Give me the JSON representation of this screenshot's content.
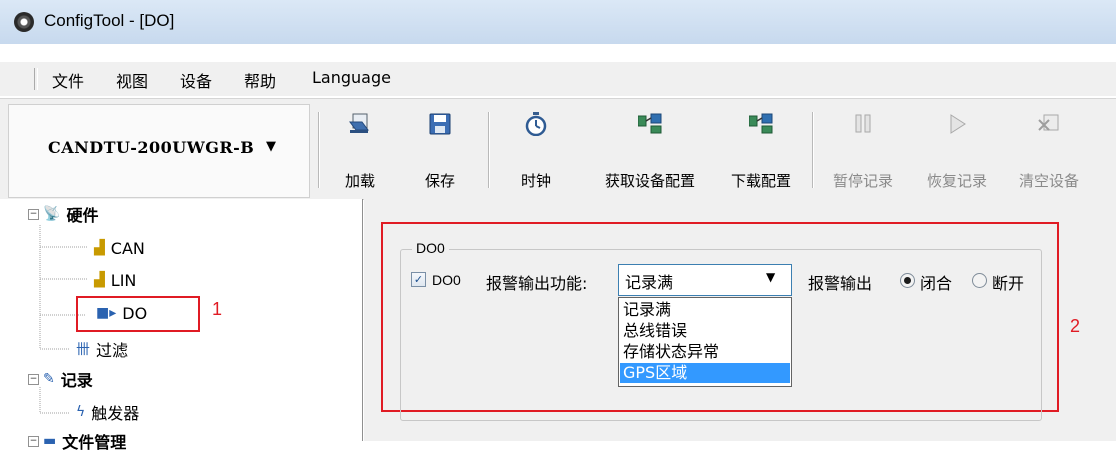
{
  "window": {
    "title": "ConfigTool - [DO]"
  },
  "menu": [
    "文件",
    "视图",
    "设备",
    "帮助",
    "Language"
  ],
  "toolbar": {
    "device": "CANDTU-200UWGR-B",
    "buttons": [
      {
        "label": "加载",
        "icon": "load-icon"
      },
      {
        "label": "保存",
        "icon": "save-icon"
      },
      {
        "label": "时钟",
        "icon": "clock-icon"
      },
      {
        "label": "获取设备配置",
        "icon": "get-config-icon"
      },
      {
        "label": "下载配置",
        "icon": "download-config-icon"
      },
      {
        "label": "暂停记录",
        "icon": "pause-icon",
        "disabled": true
      },
      {
        "label": "恢复记录",
        "icon": "resume-icon",
        "disabled": true
      },
      {
        "label": "清空设备",
        "icon": "clear-icon",
        "disabled": true
      }
    ]
  },
  "tree": {
    "hardware": "硬件",
    "can": "CAN",
    "lin": "LIN",
    "do": "DO",
    "filter": "过滤",
    "record": "记录",
    "trigger": "触发器",
    "file_mgmt": "文件管理"
  },
  "annotations": {
    "one": "1",
    "two": "2"
  },
  "do_panel": {
    "group_title": "DO0",
    "checkbox_label": "DO0",
    "checkbox_checked": true,
    "function_label": "报警输出功能:",
    "function_value": "记录满",
    "options": [
      "记录满",
      "总线错误",
      "存储状态异常",
      "GPS区域"
    ],
    "highlighted_option": "GPS区域",
    "output_label": "报警输出",
    "radio_close": "闭合",
    "radio_open": "断开",
    "selected_radio": "闭合"
  },
  "colors": {
    "highlight": "#e01b24",
    "selection": "#3399ff"
  }
}
